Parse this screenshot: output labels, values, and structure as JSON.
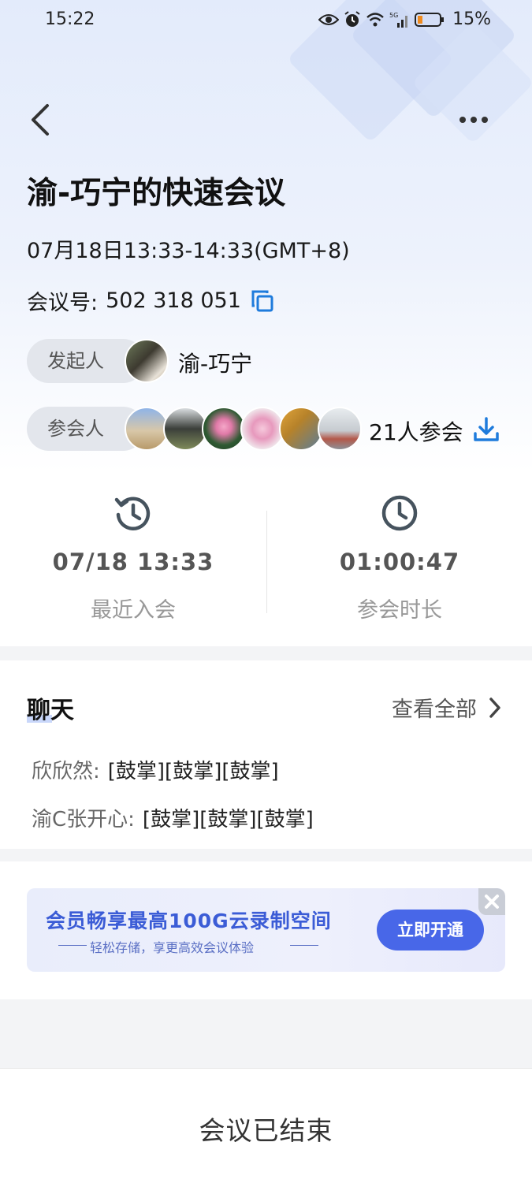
{
  "status_bar": {
    "time": "15:22",
    "battery": "15%",
    "icons": [
      "eye-icon",
      "alarm-icon",
      "wifi-icon",
      "signal-5g-icon",
      "battery-icon"
    ]
  },
  "nav": {
    "back_icon": "chevron-left-icon",
    "more_icon": "more-dots-icon"
  },
  "meeting": {
    "title": "渝-巧宁的快速会议",
    "time_range": "07月18日13:33-14:33(GMT+8)",
    "id_label": "会议号:",
    "id_value": "502 318 051",
    "copy_icon": "copy-icon"
  },
  "host": {
    "label": "发起人",
    "name": "渝-巧宁"
  },
  "participants": {
    "label": "参会人",
    "count_text": "21人参会",
    "download_icon": "download-icon"
  },
  "stats": [
    {
      "icon": "history-clock-icon",
      "value": "07/18 13:33",
      "label": "最近入会"
    },
    {
      "icon": "clock-icon",
      "value": "01:00:47",
      "label": "参会时长"
    }
  ],
  "chat": {
    "title": "聊天",
    "view_all": "查看全部",
    "messages": [
      {
        "sender": "欣欣然:",
        "text": "[鼓掌][鼓掌][鼓掌]"
      },
      {
        "sender": "渝C张开心:",
        "text": "[鼓掌][鼓掌][鼓掌]"
      }
    ]
  },
  "banner": {
    "title": "会员畅享最高100G云录制空间",
    "subtitle": "轻松存储，享更高效会议体验",
    "button": "立即开通"
  },
  "footer": {
    "status": "会议已结束"
  },
  "colors": {
    "accent": "#1e7bdc",
    "banner_accent": "#4867e8",
    "header_bg": "#e3ebfb"
  }
}
